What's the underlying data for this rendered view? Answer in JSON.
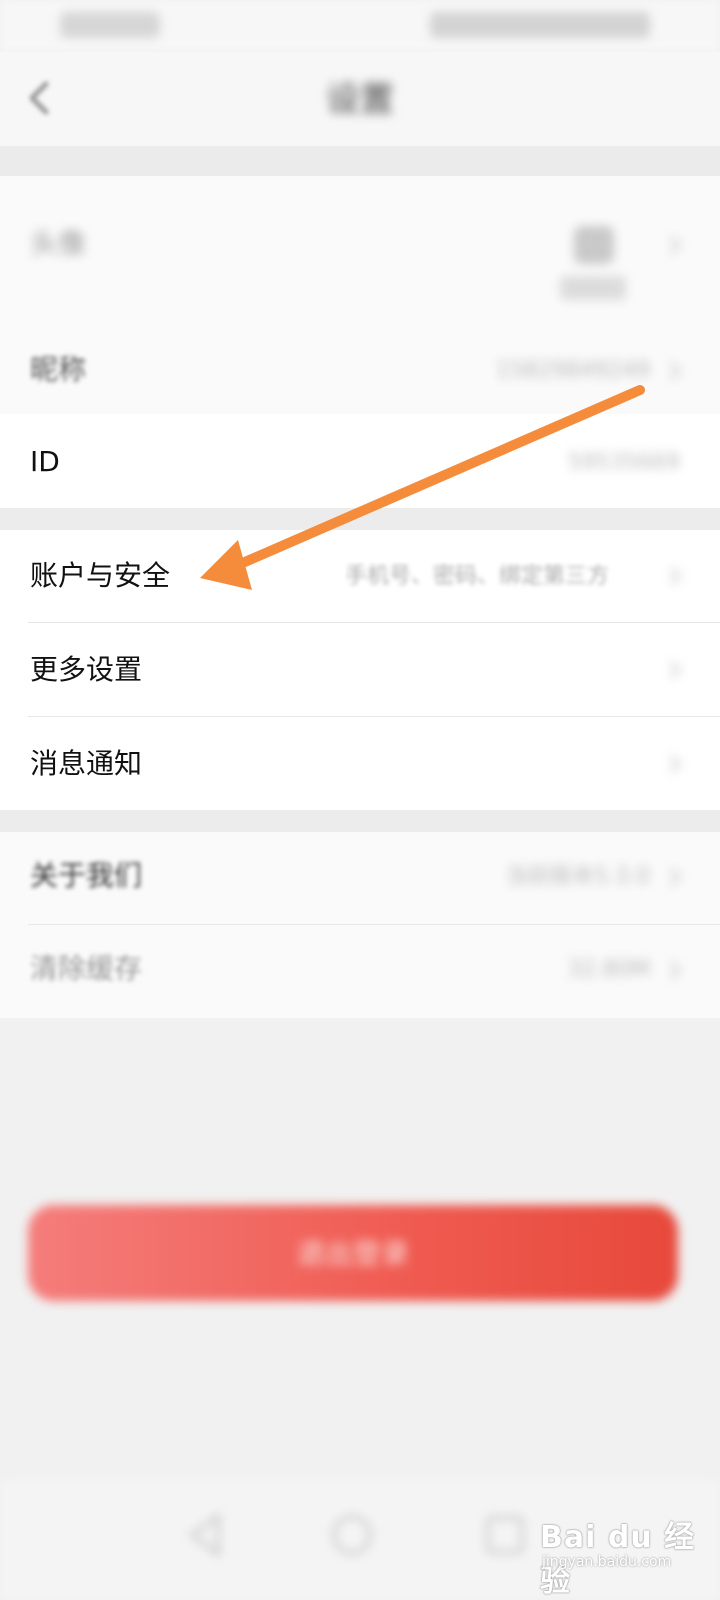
{
  "header": {
    "title": "设置"
  },
  "profile": {
    "avatar_label": "头像",
    "nickname_label": "昵称",
    "nickname_value": "15829849249",
    "id_label": "ID",
    "id_value": "59535669"
  },
  "account": {
    "security_label": "账户与安全",
    "security_value": "手机号、密码、绑定第三方",
    "more_label": "更多设置",
    "notify_label": "消息通知"
  },
  "about": {
    "about_label": "关于我们",
    "about_value": "当前版本5.3.0",
    "cache_label": "清除缓存",
    "cache_value": "32.80M"
  },
  "logout_label": "退出登录",
  "watermark": {
    "brand": "Bai du 经验",
    "url": "jingyan.baidu.com"
  },
  "colors": {
    "accent_arrow": "#f58c3c",
    "logout_start": "#f47d7b",
    "logout_end": "#e7493b"
  }
}
